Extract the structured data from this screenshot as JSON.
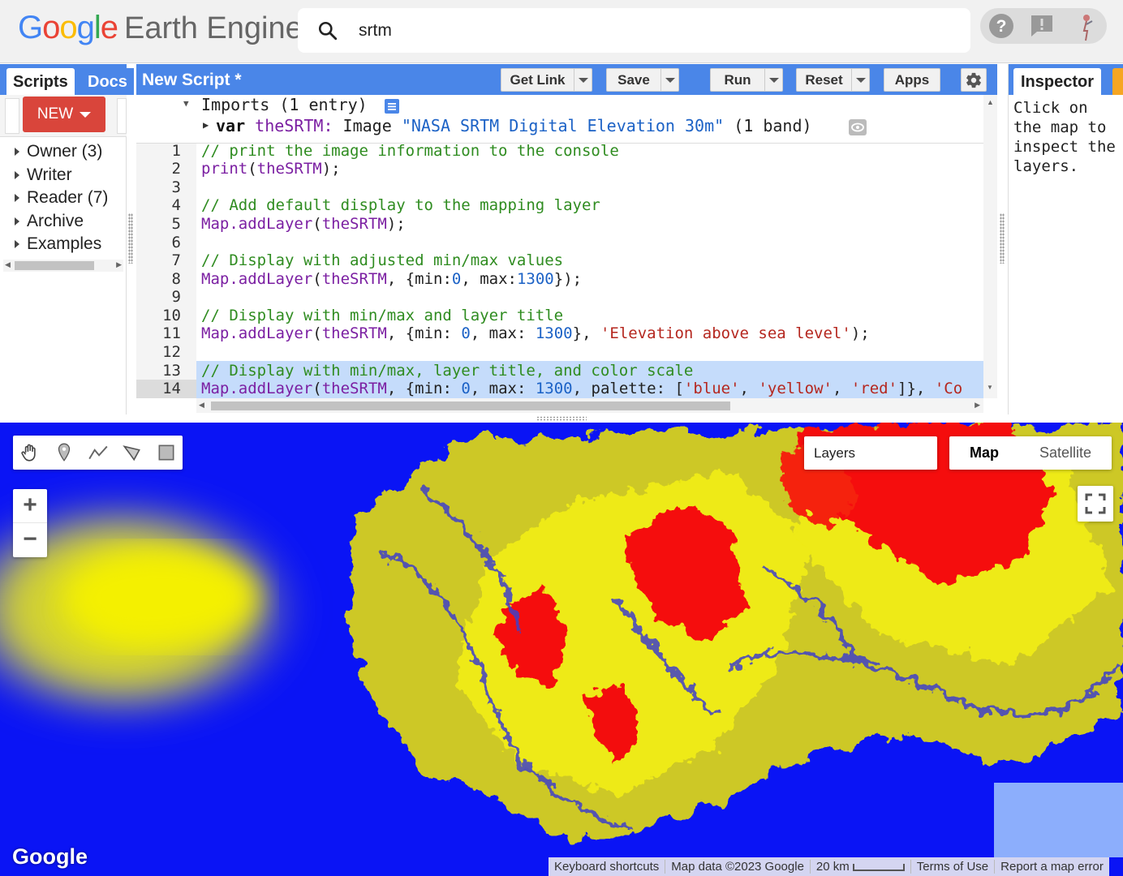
{
  "header": {
    "logo_letters": [
      "G",
      "o",
      "o",
      "g",
      "l",
      "e"
    ],
    "product": "Earth Engine",
    "search_value": "srtm",
    "icons": [
      "help-icon",
      "feedback-icon",
      "account-avatar"
    ]
  },
  "left_panel": {
    "tabs": [
      "Scripts",
      "Docs"
    ],
    "new_button": "NEW",
    "tree": [
      "Owner (3)",
      "Writer",
      "Reader (7)",
      "Archive",
      "Examples"
    ]
  },
  "editor": {
    "title": "New Script *",
    "toolbar": {
      "get_link": "Get Link",
      "save": "Save",
      "run": "Run",
      "reset": "Reset",
      "apps": "Apps"
    },
    "imports_header": "Imports (1 entry)",
    "import": {
      "keyword": "var",
      "name": "theSRTM:",
      "type": "Image",
      "title": "\"NASA SRTM Digital Elevation 30m\"",
      "bands": "(1 band)"
    },
    "line_numbers": [
      "1",
      "2",
      "3",
      "4",
      "5",
      "6",
      "7",
      "8",
      "9",
      "10",
      "11",
      "12",
      "13",
      "14"
    ],
    "code": {
      "l1": "// print the image information to the console",
      "l2_fn": "print",
      "l2_open": "(",
      "l2_var": "theSRTM",
      "l2_close": ");",
      "l4": "// Add default display to the mapping layer",
      "l5_fn": "Map.addLayer",
      "l5_open": "(",
      "l5_var": "theSRTM",
      "l5_close": ");",
      "l7": "// Display with adjusted min/max values",
      "l8_fn": "Map.addLayer",
      "l8_open": "(",
      "l8_var": "theSRTM",
      "l8_a": ", {min:",
      "l8_n1": "0",
      "l8_b": ", max:",
      "l8_n2": "1300",
      "l8_c": "});",
      "l10": "// Display with min/max and layer title",
      "l11_fn": "Map.addLayer",
      "l11_open": "(",
      "l11_var": "theSRTM",
      "l11_a": ", {min: ",
      "l11_n1": "0",
      "l11_b": ", max: ",
      "l11_n2": "1300",
      "l11_c": "}, ",
      "l11_s": "'Elevation above sea level'",
      "l11_d": ");",
      "l13": "// Display with min/max, layer title, and color scale",
      "l14_fn": "Map.addLayer",
      "l14_open": "(",
      "l14_var": "theSRTM",
      "l14_a": ", {min: ",
      "l14_n1": "0",
      "l14_b": ", max: ",
      "l14_n2": "1300",
      "l14_c": ", palette: [",
      "l14_s1": "'blue'",
      "l14_d": ", ",
      "l14_s2": "'yellow'",
      "l14_e": ", ",
      "l14_s3": "'red'",
      "l14_f": "]}, ",
      "l14_s4": "'Co"
    }
  },
  "right_panel": {
    "tab": "Inspector",
    "message": "Click on the map to inspect the layers."
  },
  "map": {
    "layers_label": "Layers",
    "map_type": [
      "Map",
      "Satellite"
    ],
    "selected_type": "Map",
    "zoom_in": "+",
    "zoom_out": "−",
    "watermark": "Google",
    "footer": {
      "shortcuts": "Keyboard shortcuts",
      "attribution": "Map data ©2023 Google",
      "scale": "20 km",
      "terms": "Terms of Use",
      "report": "Report a map error"
    },
    "palette": {
      "low": "#0a14f5",
      "mid": "#f5f20a",
      "high": "#f50a0a"
    }
  }
}
